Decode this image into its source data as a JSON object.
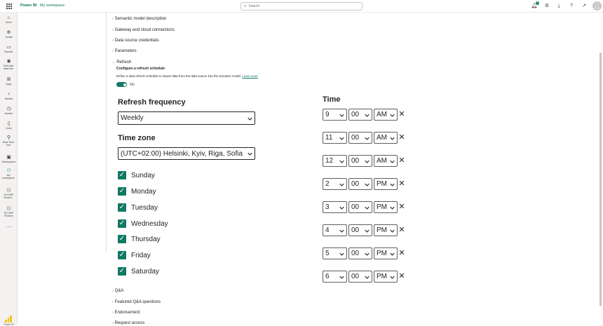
{
  "header": {
    "brand": "Power BI",
    "breadcrumb": "My workspace",
    "search_placeholder": "Search",
    "notification_count": "2",
    "icons": [
      "waffle-icon",
      "bell-icon",
      "gear-icon",
      "download-icon",
      "help-icon",
      "share-icon",
      "avatar-icon"
    ]
  },
  "leftnav": {
    "items": [
      {
        "label": "Home",
        "icon": "home-icon"
      },
      {
        "label": "Create",
        "icon": "create-icon"
      },
      {
        "label": "Browse",
        "icon": "browse-icon"
      },
      {
        "label": "OneLake data hub",
        "icon": "onelake-icon"
      },
      {
        "label": "Apps",
        "icon": "apps-icon"
      },
      {
        "label": "Metrics",
        "icon": "metrics-icon"
      },
      {
        "label": "Monitor",
        "icon": "monitor-icon"
      },
      {
        "label": "Learn",
        "icon": "learn-icon"
      },
      {
        "label": "Real-Time hub",
        "icon": "realtime-icon"
      },
      {
        "label": "Workspaces",
        "icon": "workspaces-icon"
      },
      {
        "label": "My workspace",
        "icon": "my-workspace-icon"
      },
      {
        "label": "ECOMP Financi...",
        "icon": "report-icon"
      },
      {
        "label": "ECOMP Finance",
        "icon": "report-icon"
      }
    ],
    "more": "···",
    "footer": "Power BI"
  },
  "sections_top": [
    "Semantic model description",
    "Gateway and cloud connections",
    "Data source credentials",
    "Parameters",
    "Refresh"
  ],
  "refresh": {
    "subheading": "Configure a refresh schedule",
    "description": "Define a data refresh schedule to import data from the data source into the semantic model.",
    "learn_more": "Learn more",
    "toggle_label": "On",
    "frequency_label": "Refresh frequency",
    "frequency_value": "Weekly",
    "timezone_label": "Time zone",
    "timezone_value": "(UTC+02:00) Helsinki, Kyiv, Riga, Sofia",
    "days": [
      "Sunday",
      "Monday",
      "Tuesday",
      "Wednesday",
      "Thursday",
      "Friday",
      "Saturday"
    ],
    "time_label": "Time",
    "times": [
      {
        "hour": "9",
        "minute": "00",
        "ampm": "AM"
      },
      {
        "hour": "11",
        "minute": "00",
        "ampm": "AM"
      },
      {
        "hour": "12",
        "minute": "00",
        "ampm": "AM"
      },
      {
        "hour": "2",
        "minute": "00",
        "ampm": "PM"
      },
      {
        "hour": "3",
        "minute": "00",
        "ampm": "PM"
      },
      {
        "hour": "4",
        "minute": "00",
        "ampm": "PM"
      },
      {
        "hour": "5",
        "minute": "00",
        "ampm": "PM"
      },
      {
        "hour": "6",
        "minute": "00",
        "ampm": "PM"
      }
    ],
    "remove_symbol": "✕"
  },
  "sections_bottom": [
    "Q&A",
    "Featured Q&A questions",
    "Endorsement",
    "Request access"
  ],
  "colors": {
    "accent": "#117865",
    "text": "#252423",
    "nav_bg": "#f3f2f1"
  }
}
